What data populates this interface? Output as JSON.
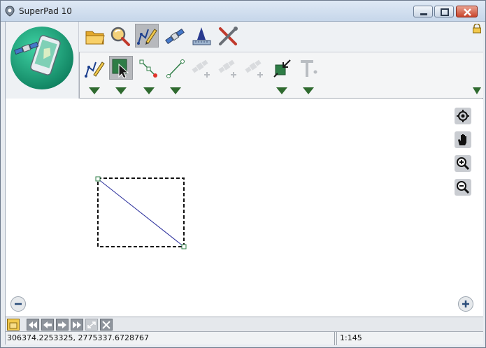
{
  "window": {
    "title": "SuperPad 10"
  },
  "colors": {
    "dropdown_arrow": "#2f6a2f",
    "selection_line": "#2b2f9c",
    "close_button": "#c8452c"
  },
  "toolbar_top": {
    "tools": [
      {
        "icon": "folder-icon"
      },
      {
        "icon": "magnify-query-icon"
      },
      {
        "icon": "edit-pencil-icon",
        "active": true
      },
      {
        "icon": "satellite-icon"
      },
      {
        "icon": "survey-measure-icon"
      },
      {
        "icon": "tools-settings-icon"
      }
    ],
    "lock_icon": "lock-icon"
  },
  "toolbar_sub": {
    "tools": [
      {
        "icon": "draw-polyline-icon",
        "has_dropdown": true
      },
      {
        "icon": "select-feature-icon",
        "active": true,
        "has_dropdown": true
      },
      {
        "icon": "edit-vertex-icon",
        "has_dropdown": true
      },
      {
        "icon": "line-segment-icon",
        "has_dropdown": true
      },
      {
        "icon": "gps-add-vertex-icon",
        "disabled": true
      },
      {
        "icon": "gps-add-point-icon",
        "disabled": true
      },
      {
        "icon": "gps-add-line-icon",
        "disabled": true
      },
      {
        "icon": "move-feature-icon",
        "has_dropdown": true
      },
      {
        "icon": "text-annotation-icon",
        "has_dropdown": true
      }
    ]
  },
  "map": {
    "side_tools": [
      "locate-gps-icon",
      "pan-hand-icon",
      "zoom-in-icon",
      "zoom-out-icon"
    ],
    "scale_controls": [
      "minus-icon",
      "plus-icon"
    ]
  },
  "navbar": {
    "buttons": [
      "layer-icon",
      "first-extent-icon",
      "prev-extent-icon",
      "next-extent-icon",
      "last-extent-icon",
      "full-extent-icon",
      "clear-icon"
    ]
  },
  "status": {
    "coordinates": "306374.2253325, 2775337.6728767",
    "scale": "1:145"
  }
}
